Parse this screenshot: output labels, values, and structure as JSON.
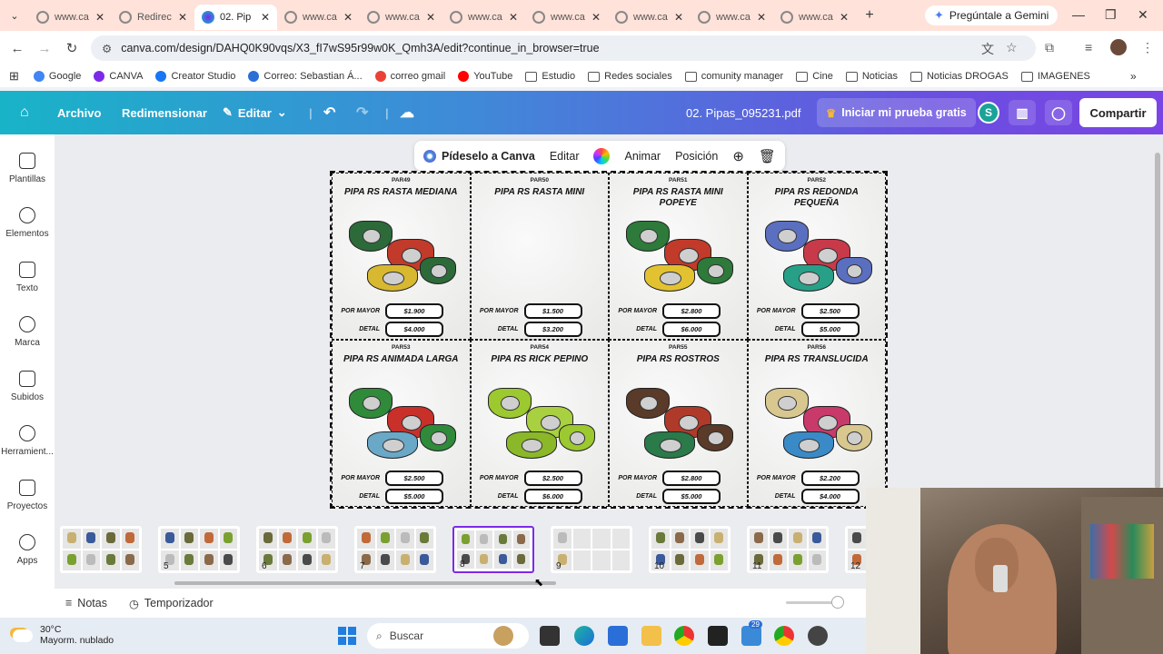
{
  "browser": {
    "tabs": [
      {
        "title": "www.ca",
        "active": false
      },
      {
        "title": "Redirec",
        "active": false
      },
      {
        "title": "02. Pip",
        "active": true
      },
      {
        "title": "www.ca",
        "active": false
      },
      {
        "title": "www.ca",
        "active": false
      },
      {
        "title": "www.ca",
        "active": false
      },
      {
        "title": "www.ca",
        "active": false
      },
      {
        "title": "www.ca",
        "active": false
      },
      {
        "title": "www.ca",
        "active": false
      },
      {
        "title": "www.ca",
        "active": false
      }
    ],
    "gemini_label": "Pregúntale a Gemini",
    "url": "canva.com/design/DAHQ0K90vqs/X3_fI7wS95r99w0K_Qmh3A/edit?continue_in_browser=true",
    "bookmarks": [
      "Google",
      "CANVA",
      "Creator Studio",
      "Correo: Sebastian Á...",
      "correo gmail",
      "YouTube",
      "Estudio",
      "Redes sociales",
      "comunity manager",
      "Cine",
      "Noticias",
      "Noticias DROGAS",
      "IMAGENES"
    ]
  },
  "canva_header": {
    "archivo": "Archivo",
    "redimensionar": "Redimensionar",
    "editar": "Editar",
    "doc_title": "02. Pipas_095231.pdf",
    "trial": "Iniciar mi prueba gratis",
    "avatar_letter": "S",
    "share": "Compartir"
  },
  "sidebar": [
    {
      "label": "Plantillas",
      "icon": "templates-icon"
    },
    {
      "label": "Elementos",
      "icon": "elements-icon"
    },
    {
      "label": "Texto",
      "icon": "text-icon"
    },
    {
      "label": "Marca",
      "icon": "brand-icon"
    },
    {
      "label": "Subidos",
      "icon": "uploads-icon"
    },
    {
      "label": "Herramient...",
      "icon": "tools-icon"
    },
    {
      "label": "Proyectos",
      "icon": "projects-icon"
    },
    {
      "label": "Apps",
      "icon": "apps-icon"
    }
  ],
  "context_toolbar": {
    "ask": "Pídeselo a Canva",
    "edit": "Editar",
    "animate": "Animar",
    "position": "Posición"
  },
  "products": [
    {
      "code": "PAR49",
      "name": "PIPA RS RASTA MEDIANA",
      "mayor": "$1.900",
      "detal": "$4.000",
      "colors": [
        "#2d6a3a",
        "#c23a2a",
        "#d8b830"
      ]
    },
    {
      "code": "PAR50",
      "name": "PIPA RS RASTA MINI",
      "mayor": "$1.500",
      "detal": "$3.200",
      "colors": []
    },
    {
      "code": "PAR51",
      "name": "PIPA RS RASTA MINI POPEYE",
      "mayor": "$2.800",
      "detal": "$6.000",
      "colors": [
        "#2d7a3a",
        "#c23a2a",
        "#e2c230"
      ]
    },
    {
      "code": "PAR52",
      "name": "PIPA RS REDONDA PEQUEÑA",
      "mayor": "$2.500",
      "detal": "$5.000",
      "colors": [
        "#5b6fc0",
        "#c83a4a",
        "#28a088"
      ]
    },
    {
      "code": "PAR53",
      "name": "PIPA RS ANIMADA LARGA",
      "mayor": "$2.500",
      "detal": "$5.000",
      "colors": [
        "#2f8a3a",
        "#c9302a",
        "#6aa8c8"
      ]
    },
    {
      "code": "PAR54",
      "name": "PIPA RS RICK PEPINO",
      "mayor": "$2.500",
      "detal": "$6.000",
      "colors": [
        "#9cc830",
        "#a8d040",
        "#8ab828"
      ]
    },
    {
      "code": "PAR55",
      "name": "PIPA RS ROSTROS",
      "mayor": "$2.800",
      "detal": "$5.000",
      "colors": [
        "#5a3a28",
        "#b03a2a",
        "#2a7a4a"
      ]
    },
    {
      "code": "PAR56",
      "name": "PIPA RS TRANSLUCIDA",
      "mayor": "$2.200",
      "detal": "$4.000",
      "colors": [
        "#d8c890",
        "#c83a6a",
        "#3a8ac8"
      ]
    }
  ],
  "price_labels": {
    "mayor": "POR MAYOR",
    "detal": "DETAL"
  },
  "thumbnails": [
    "",
    "5",
    "6",
    "7",
    "8",
    "9",
    "10",
    "11",
    "12"
  ],
  "selected_page": "8",
  "bottom": {
    "notes": "Notas",
    "timer": "Temporizador"
  },
  "taskbar": {
    "temp": "30°C",
    "weather": "Mayorm. nublado",
    "search": "Buscar",
    "badge": "29"
  }
}
